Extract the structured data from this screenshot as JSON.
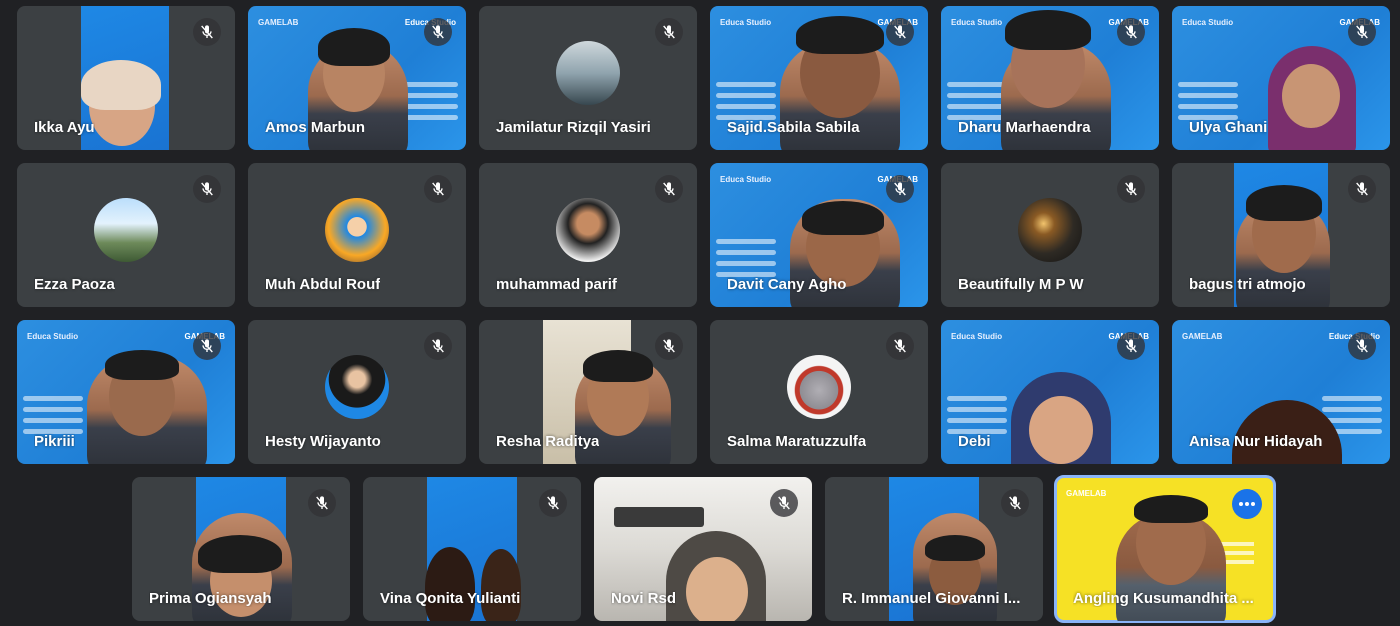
{
  "participants": [
    {
      "name": "Ikka Ayu",
      "muted": true
    },
    {
      "name": "Amos Marbun",
      "muted": true
    },
    {
      "name": "Jamilatur Rizqil Yasiri",
      "muted": true
    },
    {
      "name": "Sajid.Sabila Sabila",
      "muted": true
    },
    {
      "name": "Dharu Marhaendra",
      "muted": true
    },
    {
      "name": "Ulya Ghani",
      "muted": true
    },
    {
      "name": "Ezza Paoza",
      "muted": true
    },
    {
      "name": "Muh Abdul Rouf",
      "muted": true
    },
    {
      "name": "muhammad parif",
      "muted": true
    },
    {
      "name": "Davit Cany Agho",
      "muted": true
    },
    {
      "name": "Beautifully M P W",
      "muted": true
    },
    {
      "name": "bagus tri atmojo",
      "muted": true
    },
    {
      "name": "Pikriii",
      "muted": true
    },
    {
      "name": "Hesty Wijayanto",
      "muted": true
    },
    {
      "name": "Resha Raditya",
      "muted": true
    },
    {
      "name": "Salma Maratuzzulfa",
      "muted": true
    },
    {
      "name": "Debi",
      "muted": true
    },
    {
      "name": "Anisa Nur Hidayah",
      "muted": true
    },
    {
      "name": "Prima Ogiansyah",
      "muted": true
    },
    {
      "name": "Vina Qonita Yulianti",
      "muted": true
    },
    {
      "name": "Novi Rsd",
      "muted": true
    },
    {
      "name": "R. Immanuel Giovanni I...",
      "muted": true
    },
    {
      "name": "Angling Kusumandhita ...",
      "muted": false
    }
  ],
  "background_brand": "Educa Studio",
  "gamelab_logo": "GAMELAB",
  "icons": {
    "mute": "mic-off-icon",
    "more": "more-options-icon"
  },
  "colors": {
    "page_bg": "#202124",
    "tile_bg": "#3c4043",
    "accent": "#1a73e8",
    "active_outline": "#8ab4f8",
    "virtual_bg": "#1f7fd6",
    "speaker_bg": "#f6e125"
  }
}
